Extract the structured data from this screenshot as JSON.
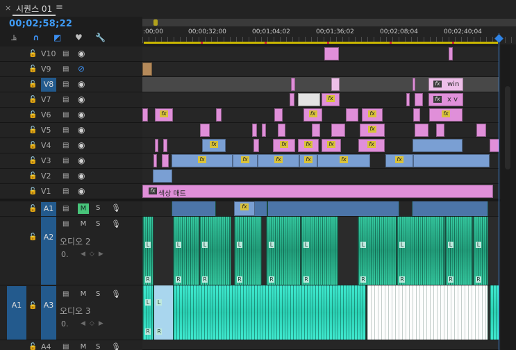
{
  "tab": {
    "close": "×",
    "title": "시퀀스 01",
    "menu": "≡"
  },
  "timecode": "00;02;58;22",
  "toolbar": {
    "icons": [
      "insert-icon",
      "snap-icon",
      "linked-icon",
      "marker-icon",
      "wrench-icon"
    ]
  },
  "ruler": {
    "ticks": [
      ":00;00",
      "00;00;32;00",
      "00;01;04;02",
      "00;01;36;02",
      "00;02;08;04",
      "00;02;40;04"
    ]
  },
  "video_tracks": [
    {
      "name": "V10",
      "eye": "on"
    },
    {
      "name": "V9",
      "eye": "off"
    },
    {
      "name": "V8",
      "eye": "on",
      "selected": true
    },
    {
      "name": "V7",
      "eye": "on"
    },
    {
      "name": "V6",
      "eye": "on"
    },
    {
      "name": "V5",
      "eye": "on"
    },
    {
      "name": "V4",
      "eye": "on"
    },
    {
      "name": "V3",
      "eye": "on"
    },
    {
      "name": "V2",
      "eye": "on"
    },
    {
      "name": "V1",
      "eye": "on"
    }
  ],
  "audio_tracks": [
    {
      "name": "A1",
      "m": "M",
      "s": "S",
      "muted": true
    },
    {
      "name": "A2",
      "label": "오디오 2",
      "m": "M",
      "s": "S",
      "vol": "0."
    },
    {
      "name": "A3",
      "src": "A1",
      "label": "오디오 3",
      "m": "M",
      "s": "S",
      "vol": "0."
    },
    {
      "name": "A4",
      "m": "M",
      "s": "S"
    }
  ],
  "clips": {
    "v8_a": "win",
    "v7_a": "x v",
    "v1": "색상 매트"
  },
  "channel_labels": {
    "L": "L",
    "R": "R"
  },
  "colors": {
    "accent": "#3f9bf5",
    "video_clip": "#e08fd9",
    "nested_clip": "#7a9fd3",
    "audio_clip": "#35c9a0"
  }
}
